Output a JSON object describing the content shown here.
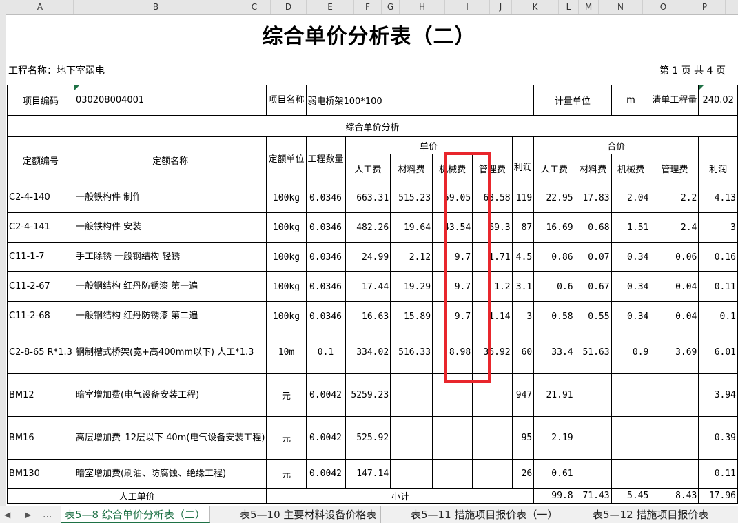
{
  "column_headers": [
    "A",
    "B",
    "C",
    "D",
    "E",
    "F",
    "G",
    "H",
    "I",
    "J",
    "K",
    "L",
    "M",
    "N",
    "O",
    "P"
  ],
  "title": "综合单价分析表（二）",
  "project": "工程名称：地下室弱电",
  "page_info": "第 1 页  共 4 页",
  "header": {
    "code_label": "项目编码",
    "code_value": "030208004001",
    "name_label": "项目名称",
    "name_value": "弱电桥架100*100",
    "unit_label": "计量单位",
    "unit_value": "m",
    "qty_label": "清单工程量",
    "qty_value": "240.02"
  },
  "section_title": "综合单价分析",
  "col": {
    "quota_code": "定额编号",
    "quota_name": "定额名称",
    "quota_unit": "定额单位",
    "quantity": "工程数量",
    "unit_price": "单价",
    "total_price": "合价",
    "labor": "人工费",
    "material": "材料费",
    "machine": "机械费",
    "mgmt": "管理费",
    "profit_short": "利润",
    "profit": "利润"
  },
  "rows": [
    {
      "code": "C2-4-140",
      "name": "一般铁构件 制作",
      "unit": "100kg",
      "qty": "0.0346",
      "labor": "663.31",
      "material": "515.23",
      "machine": "59.05",
      "mgmt": "63.58",
      "profit": "119",
      "t_labor": "22.95",
      "t_material": "17.83",
      "t_machine": "2.04",
      "t_mgmt": "2.2",
      "t_profit": "4.13"
    },
    {
      "code": "C2-4-141",
      "name": "一般铁构件 安装",
      "unit": "100kg",
      "qty": "0.0346",
      "labor": "482.26",
      "material": "19.64",
      "machine": "43.54",
      "mgmt": "69.3",
      "profit": "87",
      "t_labor": "16.69",
      "t_material": "0.68",
      "t_machine": "1.51",
      "t_mgmt": "2.4",
      "t_profit": "3"
    },
    {
      "code": "C11-1-7",
      "name": "手工除锈 一般钢结构 轻锈",
      "unit": "100kg",
      "qty": "0.0346",
      "labor": "24.99",
      "material": "2.12",
      "machine": "9.7",
      "mgmt": "1.71",
      "profit": "4.5",
      "t_labor": "0.86",
      "t_material": "0.07",
      "t_machine": "0.34",
      "t_mgmt": "0.06",
      "t_profit": "0.16"
    },
    {
      "code": "C11-2-67",
      "name": "一般钢结构 红丹防锈漆 第一遍",
      "unit": "100kg",
      "qty": "0.0346",
      "labor": "17.44",
      "material": "19.29",
      "machine": "9.7",
      "mgmt": "1.2",
      "profit": "3.1",
      "t_labor": "0.6",
      "t_material": "0.67",
      "t_machine": "0.34",
      "t_mgmt": "0.04",
      "t_profit": "0.11"
    },
    {
      "code": "C11-2-68",
      "name": "一般钢结构 红丹防锈漆 第二遍",
      "unit": "100kg",
      "qty": "0.0346",
      "labor": "16.63",
      "material": "15.89",
      "machine": "9.7",
      "mgmt": "1.14",
      "profit": "3",
      "t_labor": "0.58",
      "t_material": "0.55",
      "t_machine": "0.34",
      "t_mgmt": "0.04",
      "t_profit": "0.1"
    },
    {
      "code": "C2-8-65 R*1.3",
      "name": "钢制槽式桥架(宽+高400mm以下) 人工*1.3",
      "unit": "10m",
      "qty": "0.1",
      "labor": "334.02",
      "material": "516.33",
      "machine": "8.98",
      "mgmt": "36.92",
      "profit": "60",
      "t_labor": "33.4",
      "t_material": "51.63",
      "t_machine": "0.9",
      "t_mgmt": "3.69",
      "t_profit": "6.01"
    },
    {
      "code": "BM12",
      "name": "暗室增加费(电气设备安装工程)",
      "unit": "元",
      "qty": "0.0042",
      "labor": "5259.23",
      "material": "",
      "machine": "",
      "mgmt": "",
      "profit": "947",
      "t_labor": "21.91",
      "t_material": "",
      "t_machine": "",
      "t_mgmt": "",
      "t_profit": "3.94"
    },
    {
      "code": "BM16",
      "name": "高层增加费_12层以下 40m(电气设备安装工程)",
      "unit": "元",
      "qty": "0.0042",
      "labor": "525.92",
      "material": "",
      "machine": "",
      "mgmt": "",
      "profit": "95",
      "t_labor": "2.19",
      "t_material": "",
      "t_machine": "",
      "t_mgmt": "",
      "t_profit": "0.39"
    },
    {
      "code": "BM130",
      "name": "暗室增加费(刷油、防腐蚀、绝缘工程)",
      "unit": "元",
      "qty": "0.0042",
      "labor": "147.14",
      "material": "",
      "machine": "",
      "mgmt": "",
      "profit": "26",
      "t_labor": "0.61",
      "t_material": "",
      "t_machine": "",
      "t_mgmt": "",
      "t_profit": "0.11"
    }
  ],
  "footer": {
    "labor_unit_price": "人工单价",
    "subtotal": "小计",
    "t_labor": "99.8",
    "t_material": "71.43",
    "t_machine": "5.45",
    "t_mgmt": "8.43",
    "t_profit": "17.96"
  },
  "sheet_tabs": {
    "ellipsis": "...",
    "tabs": [
      "表5—8 综合单价分析表（二）",
      "表5—10 主要材料设备价格表",
      "表5—11 措施项目报价表（一）",
      "表5—12 措施项目报价表"
    ]
  },
  "colors": {
    "highlight": "#e8262c",
    "active_tab": "#1e7145"
  }
}
